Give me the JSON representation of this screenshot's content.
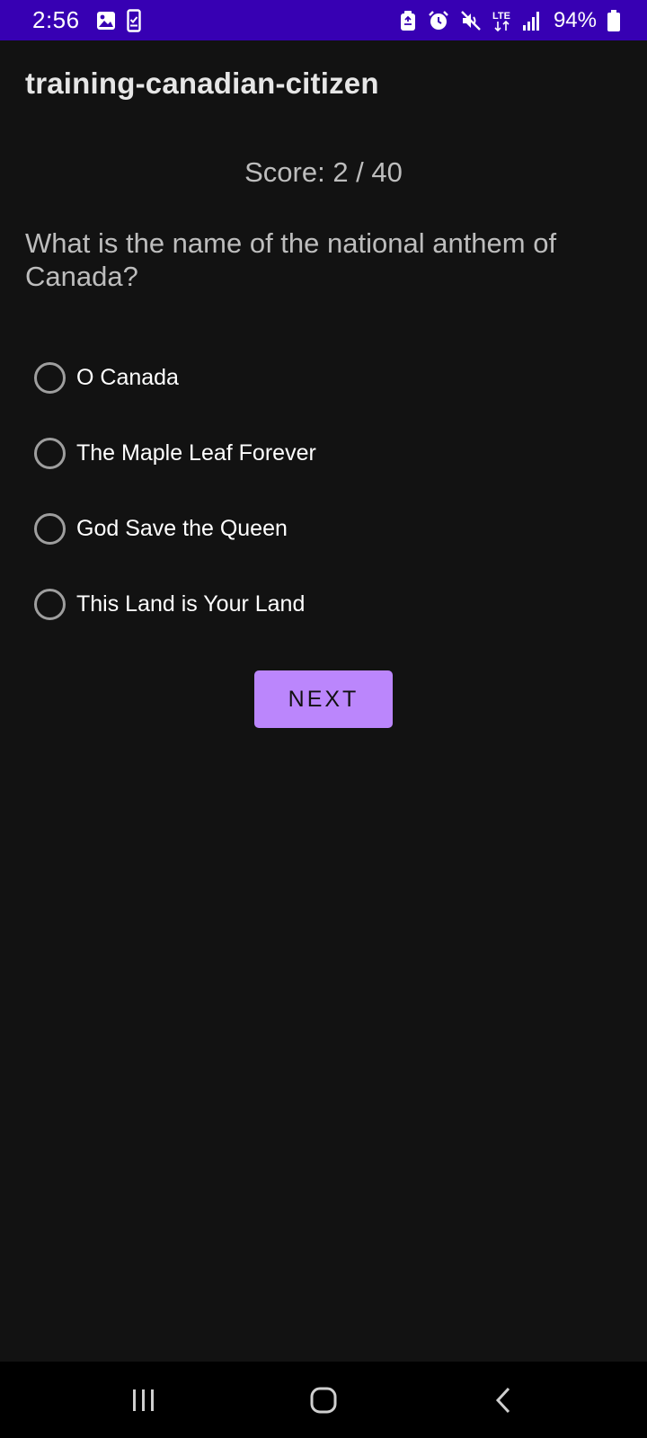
{
  "colors": {
    "status_bar": "#3700b3",
    "background": "#121212",
    "accent": "#bb86fc"
  },
  "status_bar": {
    "time": "2:56",
    "left_icons": [
      "gallery-icon",
      "phone-checklist-icon"
    ],
    "right_icons": [
      "recycle-icon",
      "alarm-icon",
      "mute-icon",
      "lte-icon",
      "signal-icon"
    ],
    "network": "LTE",
    "battery": "94%"
  },
  "app": {
    "title": "training-canadian-citizen"
  },
  "quiz": {
    "score": "Score: 2 / 40",
    "question": "What is the name of the national anthem of Canada?",
    "options": [
      {
        "label": "O Canada",
        "selected": false
      },
      {
        "label": "The Maple Leaf Forever",
        "selected": false
      },
      {
        "label": "God Save the Queen",
        "selected": false
      },
      {
        "label": "This Land is Your Land",
        "selected": false
      }
    ],
    "next_label": "NEXT"
  },
  "nav_bar": {
    "buttons": [
      "recent-apps-icon",
      "home-icon",
      "back-icon"
    ]
  }
}
